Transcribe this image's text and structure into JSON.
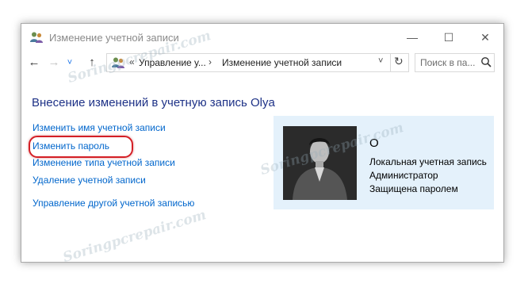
{
  "window": {
    "title": "Изменение учетной записи",
    "controls": {
      "minimize": "—",
      "maximize": "☐",
      "close": "✕"
    }
  },
  "nav": {
    "back": "←",
    "forward": "→",
    "recent": "˅",
    "up": "↑",
    "address": {
      "prefix": "«",
      "crumbs": [
        "Управление у...",
        "Изменение учетной записи"
      ],
      "separator": "›",
      "dropdown": "˅",
      "refresh": "↻"
    },
    "search_placeholder": "Поиск в па..."
  },
  "main": {
    "heading": "Внесение изменений в учетную запись Olya",
    "links": [
      "Изменить имя учетной записи",
      "Изменить пароль",
      "Изменение типа учетной записи",
      "Удаление учетной записи",
      "Управление другой учетной записью"
    ],
    "highlighted_link_index": 1
  },
  "user": {
    "name": "O",
    "lines": [
      "Локальная учетная запись",
      "Администратор",
      "Защищена паролем"
    ]
  },
  "watermark": "Soringpcrepair.com",
  "colors": {
    "heading": "#1e3287",
    "link": "#0066cc",
    "panel": "#e4f1fb",
    "highlight": "#d41f26",
    "nav_active": "#1a73e8"
  },
  "icons": {
    "app": "users-icon",
    "breadcrumb": "users-icon",
    "search": "search-icon",
    "refresh": "refresh-icon"
  }
}
